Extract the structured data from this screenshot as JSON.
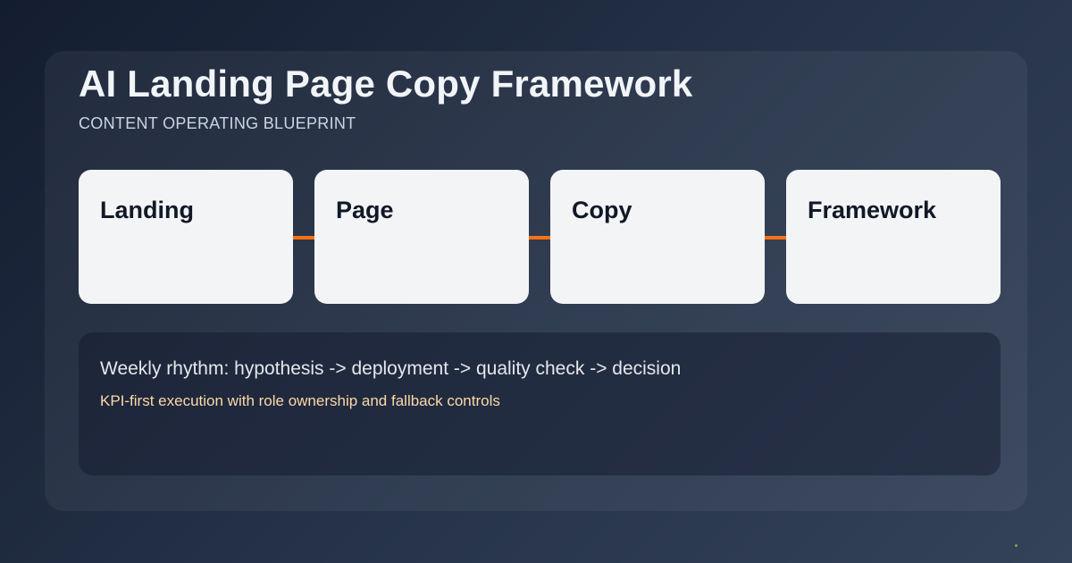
{
  "header": {
    "title": "AI Landing Page Copy Framework",
    "subtitle": "CONTENT OPERATING BLUEPRINT"
  },
  "steps": [
    {
      "label": "Landing"
    },
    {
      "label": "Page"
    },
    {
      "label": "Copy"
    },
    {
      "label": "Framework"
    }
  ],
  "info": {
    "main": "Weekly rhythm: hypothesis -> deployment -> quality check -> decision",
    "sub": "KPI-first execution with role ownership and fallback controls"
  },
  "colors": {
    "accent": "#f97316",
    "card": "#f3f4f6",
    "highlight_text": "#fcd9a8"
  }
}
